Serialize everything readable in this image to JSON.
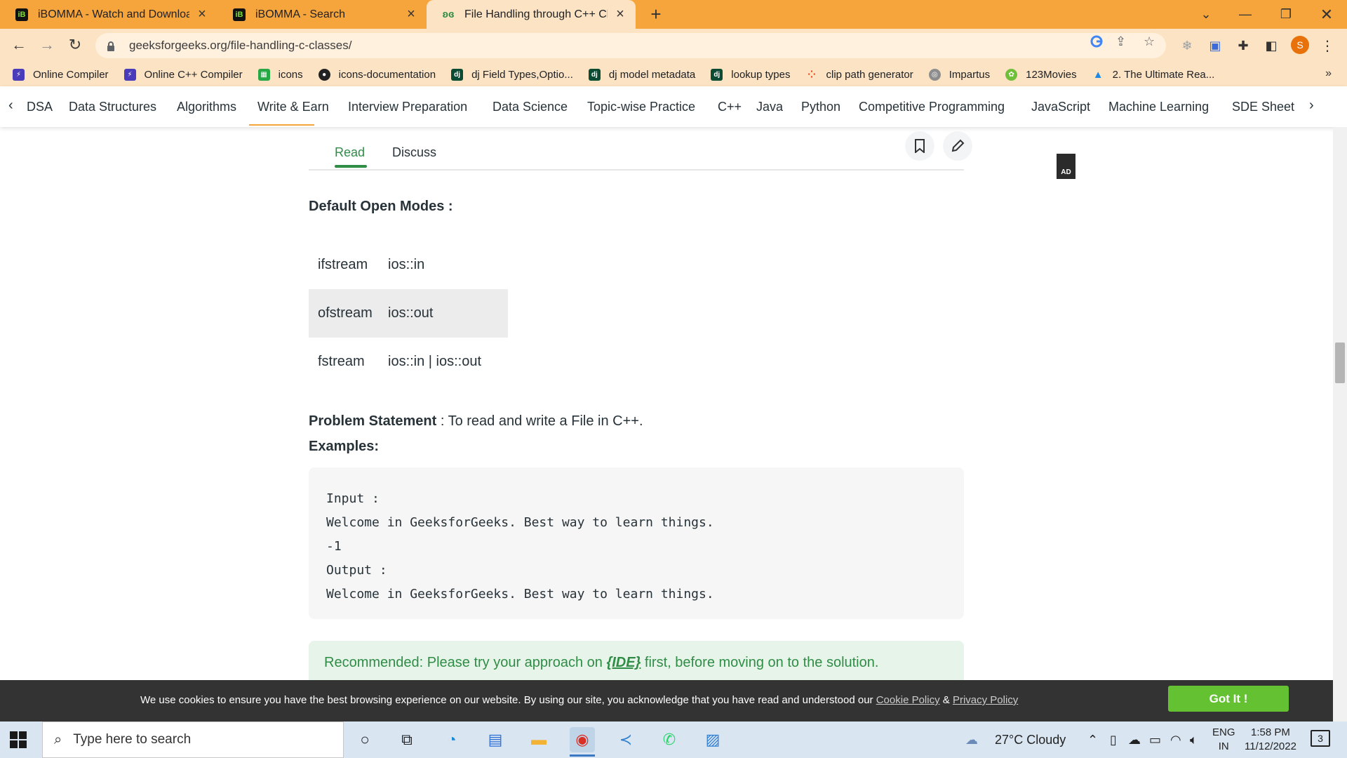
{
  "browser": {
    "tabs": [
      {
        "title": "iBOMMA - Watch and Download",
        "favicon": "iB"
      },
      {
        "title": "iBOMMA - Search",
        "favicon": "iB"
      },
      {
        "title": "File Handling through C++ Class",
        "favicon": "gfg"
      }
    ],
    "new_tab": "+",
    "url": "geeksforgeeks.org/file-handling-c-classes/",
    "profile_initial": "S",
    "bookmarks": [
      {
        "label": "Online Compiler",
        "icon": "bolt-icon",
        "color": "#4a3bbb"
      },
      {
        "label": "Online C++ Compiler",
        "icon": "bolt-icon",
        "color": "#4a3bbb"
      },
      {
        "label": "icons",
        "icon": "grid-icon",
        "color": "#28a745"
      },
      {
        "label": "icons-documentation",
        "icon": "github-icon",
        "color": "#222222"
      },
      {
        "label": "dj Field Types,Optio...",
        "icon": "dj-icon",
        "color": "#0c4b33"
      },
      {
        "label": "dj model metadata",
        "icon": "dj-icon",
        "color": "#0c4b33"
      },
      {
        "label": "lookup types",
        "icon": "dj-icon",
        "color": "#0c4b33"
      },
      {
        "label": "clip path generator",
        "icon": "dots-icon",
        "color": "#e64a19"
      },
      {
        "label": "Impartus",
        "icon": "globe-icon",
        "color": "#8d8d8d"
      },
      {
        "label": "123Movies",
        "icon": "film-icon",
        "color": "#6fbf3a"
      },
      {
        "label": "2. The Ultimate Rea...",
        "icon": "drive-icon",
        "color": "#1e88e5"
      }
    ],
    "bookmarks_more": "»"
  },
  "site_nav": {
    "items": [
      "DSA",
      "Data Structures",
      "Algorithms",
      "Write & Earn",
      "Interview Preparation",
      "Data Science",
      "Topic-wise Practice",
      "C++",
      "Java",
      "Python",
      "Competitive Programming",
      "JavaScript",
      "Machine Learning",
      "SDE Sheet"
    ],
    "active": "Write & Earn"
  },
  "article": {
    "tabs": {
      "read": "Read",
      "discuss": "Discuss"
    },
    "ad_label": "AD",
    "heading": "Default Open Modes :",
    "modes": [
      {
        "stream": "ifstream",
        "mode": "ios::in"
      },
      {
        "stream": "ofstream",
        "mode": "ios::out"
      },
      {
        "stream": "fstream",
        "mode": "ios::in | ios::out"
      }
    ],
    "problem_label": "Problem Statement",
    "problem_text": " : To read and write a File in C++.",
    "examples_label": "Examples:",
    "code_lines": [
      "Input :",
      "Welcome in GeeksforGeeks. Best way to learn things.",
      "-1",
      "Output :",
      "Welcome in GeeksforGeeks. Best way to learn things."
    ],
    "recommended_prefix": "Recommended: Please try your approach on ",
    "recommended_link": "{IDE}",
    "recommended_suffix": " first, before moving on to the solution."
  },
  "cookie": {
    "message": "We use cookies to ensure you have the best browsing experience on our website. By using our site, you acknowledge that you have read and understood our ",
    "cookie_policy": "Cookie Policy",
    "amp": " & ",
    "privacy_policy": "Privacy Policy",
    "button": "Got It !"
  },
  "taskbar": {
    "search_placeholder": "Type here to search",
    "weather": "27°C  Cloudy",
    "lang_top": "ENG",
    "lang_bottom": "IN",
    "time": "1:58 PM",
    "date": "11/12/2022",
    "notifications": "3"
  },
  "colors": {
    "accent": "#2f8d46",
    "chrome": "#f6a53c",
    "cookie_button": "#63c132"
  }
}
